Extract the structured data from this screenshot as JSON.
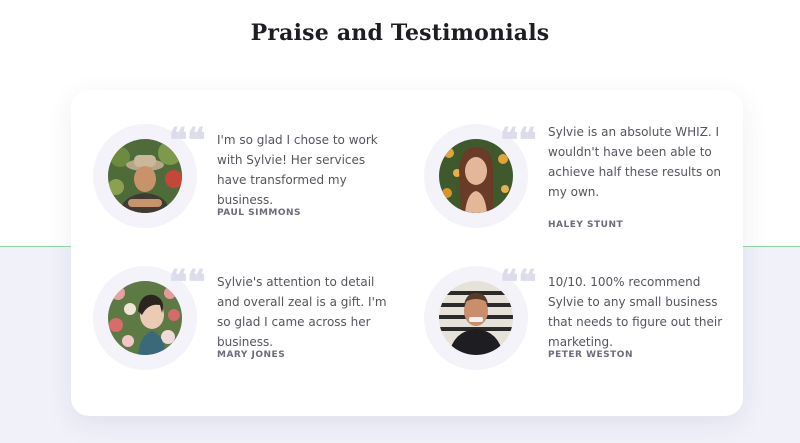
{
  "page": {
    "title": "Praise and Testimonials"
  },
  "testimonials": [
    {
      "quote": "I'm so glad I chose to work with Sylvie! Her services have transformed my business.",
      "name": "PAUL SIMMONS",
      "quote_icon": "quote-mark-icon"
    },
    {
      "quote": "Sylvie is an absolute WHIZ. I wouldn't have been able to achieve half these results on my own.",
      "name": "HALEY STUNT",
      "quote_icon": "quote-mark-icon"
    },
    {
      "quote": "Sylvie's attention to detail and overall zeal is a gift. I'm so glad I came across her business.",
      "name": "MARY JONES",
      "quote_icon": "quote-mark-icon"
    },
    {
      "quote": "10/10. 100% recommend Sylvie to any small business that needs to figure out their marketing.",
      "name": "PETER WESTON",
      "quote_icon": "quote-mark-icon"
    }
  ],
  "colors": {
    "title": "#1d1d22",
    "body_text": "#55555e",
    "name_text": "#6c6c7a",
    "divider": "#8fd9a6",
    "lower_background": "#f1f1fa"
  }
}
